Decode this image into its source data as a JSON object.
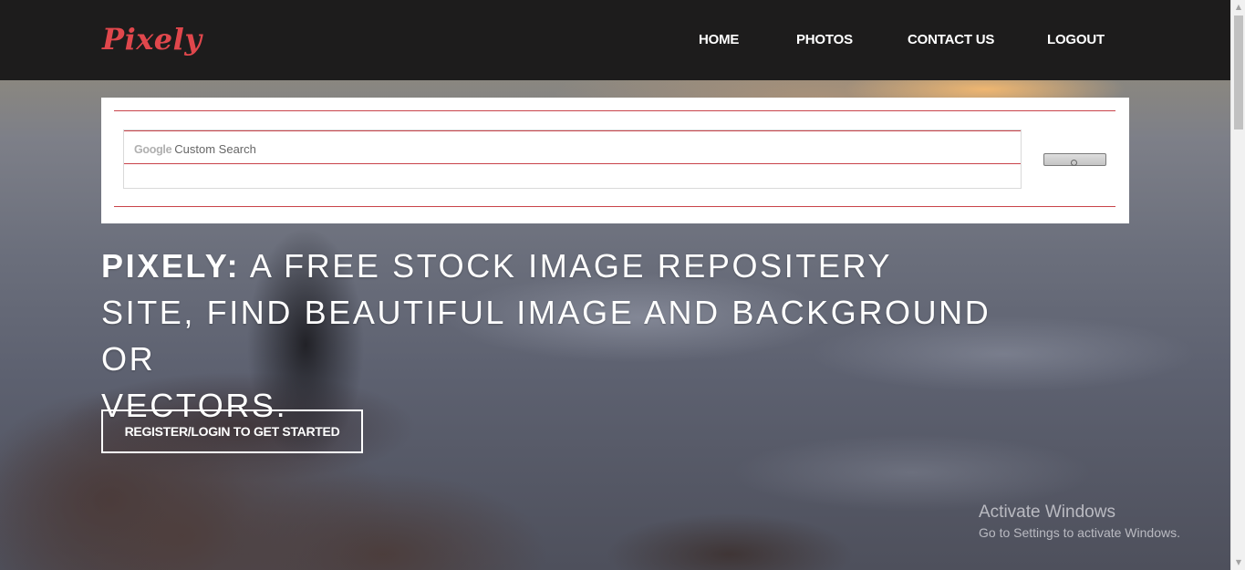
{
  "nav": {
    "logo": "Pixely",
    "links": [
      {
        "label": "HOME"
      },
      {
        "label": "PHOTOS"
      },
      {
        "label": "CONTACT US"
      },
      {
        "label": "LOGOUT"
      }
    ]
  },
  "search": {
    "brand_google": "Google",
    "brand_custom": "Custom Search",
    "value": "",
    "button_icon": "search-icon"
  },
  "hero": {
    "headline_brand": "PIXELY:",
    "headline_line1_rest": " A FREE STOCK IMAGE REPOSITERY",
    "headline_line2": "SITE, FIND BEAUTIFUL IMAGE AND BACKGROUND OR",
    "headline_line3": "VECTORS.",
    "cta_label": "REGISTER/LOGIN TO GET STARTED"
  },
  "watermark": {
    "title": "Activate Windows",
    "subtitle": "Go to Settings to activate Windows."
  },
  "colors": {
    "navbar_bg": "#1d1c1c",
    "logo": "#e0474c",
    "accent_rule": "#c9434a",
    "text_light": "#ffffff"
  }
}
